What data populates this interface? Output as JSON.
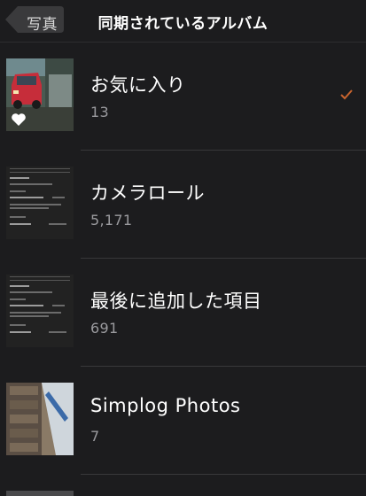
{
  "nav": {
    "back_label": "写真",
    "title": "同期されているアルバム"
  },
  "albums": [
    {
      "name": "お気に入り",
      "count": "13",
      "selected": true,
      "thumb_icon": "car-photo-with-heart-icon"
    },
    {
      "name": "カメラロール",
      "count": "5,171",
      "selected": false,
      "thumb_icon": "settings-screenshot"
    },
    {
      "name": "最後に追加した項目",
      "count": "691",
      "selected": false,
      "thumb_icon": "settings-screenshot"
    },
    {
      "name": "Simplog Photos",
      "count": "7",
      "selected": false,
      "thumb_icon": "building-photo"
    }
  ],
  "colors": {
    "background": "#1c1c1e",
    "checkmark": "#c8642e",
    "count_text": "#9a9a9e"
  }
}
